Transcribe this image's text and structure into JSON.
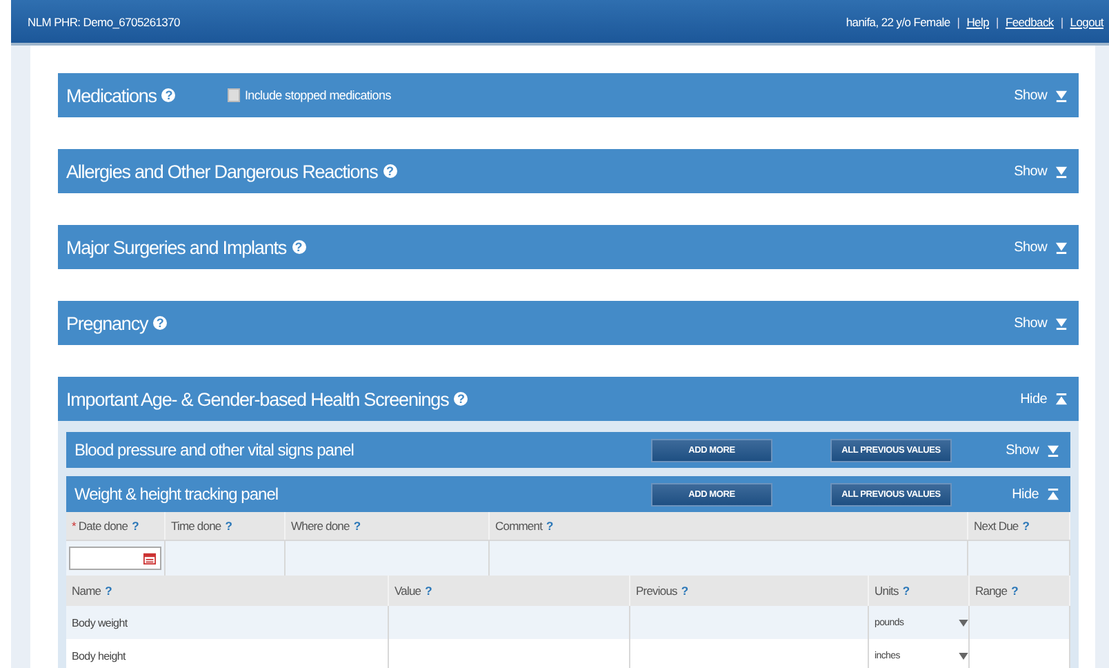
{
  "header": {
    "title": "NLM PHR: Demo_6705261370",
    "user": "hanifa, 22 y/o Female",
    "separator": "|",
    "links": [
      "Help",
      "Feedback",
      "Logout"
    ]
  },
  "sections": [
    {
      "title": "Medications",
      "help": "?",
      "option": {
        "label": "Include stopped medications",
        "checked": false
      },
      "toggle": "Show",
      "expanded": false
    },
    {
      "title": "Allergies and Other Dangerous Reactions",
      "help": "?",
      "toggle": "Show",
      "expanded": false
    },
    {
      "title": "Major Surgeries and Implants",
      "help": "?",
      "toggle": "Show",
      "expanded": false
    },
    {
      "title": "Pregnancy",
      "help": "?",
      "toggle": "Show",
      "expanded": false
    },
    {
      "title": "Important Age- & Gender-based Health Screenings",
      "help": "?",
      "toggle": "Hide",
      "expanded": true,
      "panels": [
        {
          "title": "Blood pressure and other vital signs panel",
          "add": "ADD MORE",
          "previous": "ALL PREVIOUS VALUES",
          "toggle": "Show",
          "expanded": false
        },
        {
          "title": "Weight & height tracking panel",
          "add": "ADD MORE",
          "previous": "ALL PREVIOUS VALUES",
          "toggle": "Hide",
          "expanded": true,
          "required_mark": "*",
          "date_columns": [
            {
              "label": "Date done",
              "help": "?",
              "required": true
            },
            {
              "label": "Time done",
              "help": "?",
              "required": false
            },
            {
              "label": "Where done",
              "help": "?",
              "required": false
            },
            {
              "label": "Comment",
              "help": "?",
              "required": false
            },
            {
              "label": "Next Due",
              "help": "?",
              "required": false
            }
          ],
          "columns": [
            {
              "label": "Name",
              "help": "?"
            },
            {
              "label": "Value",
              "help": "?"
            },
            {
              "label": "Previous",
              "help": "?"
            },
            {
              "label": "Units",
              "help": "?"
            },
            {
              "label": "Range",
              "help": "?"
            }
          ],
          "rows": [
            {
              "name": "Body weight",
              "units": "pounds"
            },
            {
              "name": "Body height",
              "units": "inches"
            }
          ]
        }
      ]
    }
  ]
}
